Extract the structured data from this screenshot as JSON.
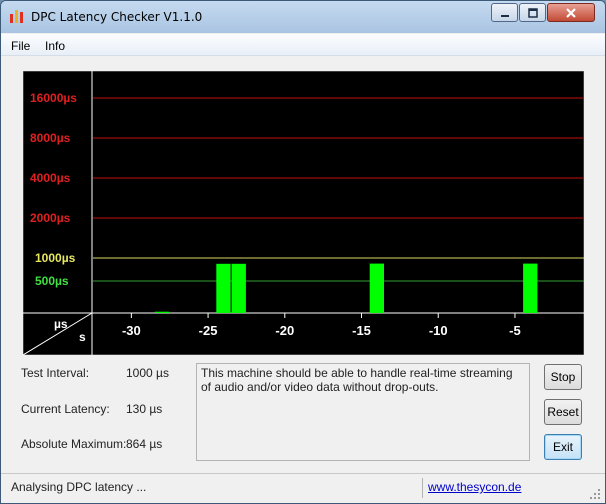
{
  "window": {
    "title": "DPC Latency Checker V1.1.0"
  },
  "menu": {
    "items": [
      "File",
      "Info"
    ]
  },
  "graph": {
    "y_labels": [
      {
        "text": "16000µs",
        "color": "#e02020"
      },
      {
        "text": "8000µs",
        "color": "#e02020"
      },
      {
        "text": "4000µs",
        "color": "#e02020"
      },
      {
        "text": "2000µs",
        "color": "#e02020"
      },
      {
        "text": "1000µs",
        "color": "#e8e860"
      },
      {
        "text": "500µs",
        "color": "#40e040"
      }
    ],
    "unit_label_top": "µs",
    "unit_label_bottom": "s",
    "x_ticks": [
      "-30",
      "-25",
      "-20",
      "-15",
      "-10",
      "-5"
    ],
    "colors": {
      "background": "#000000",
      "bar": "#00ff00",
      "red_line": "#c01010",
      "yellow_line": "#d8d860",
      "green_line": "#30a030"
    }
  },
  "chart_data": {
    "type": "bar",
    "title": "",
    "xlabel": "s",
    "ylabel": "µs",
    "x": [
      -32,
      -31,
      -30,
      -29,
      -28,
      -27,
      -26,
      -25,
      -24,
      -23,
      -22,
      -21,
      -20,
      -19,
      -18,
      -17,
      -16,
      -15,
      -14,
      -13,
      -12,
      -11,
      -10,
      -9,
      -8,
      -7,
      -6,
      -5,
      -4,
      -3,
      -2,
      -1
    ],
    "values": [
      130,
      140,
      130,
      140,
      190,
      130,
      130,
      130,
      860,
      860,
      120,
      120,
      130,
      110,
      120,
      140,
      130,
      170,
      864,
      130,
      130,
      150,
      130,
      110,
      130,
      140,
      130,
      130,
      864,
      130,
      140,
      140
    ],
    "y_scale": "log",
    "ylim": [
      50,
      16000
    ]
  },
  "info": {
    "test_interval_label": "Test Interval:",
    "test_interval_value": "1000 µs",
    "current_latency_label": "Current Latency:",
    "current_latency_value": "130 µs",
    "absolute_maximum_label": "Absolute Maximum:",
    "absolute_maximum_value": "864 µs",
    "message": "This machine should be able to handle real-time streaming of audio and/or video data without drop-outs."
  },
  "buttons": {
    "stop": "Stop",
    "reset": "Reset",
    "exit": "Exit"
  },
  "status": {
    "text": "Analysing DPC latency ...",
    "link": "www.thesycon.de"
  }
}
